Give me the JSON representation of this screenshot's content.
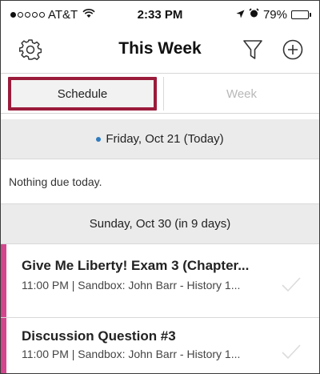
{
  "status_bar": {
    "carrier": "AT&T",
    "time": "2:33 PM",
    "battery": "79%",
    "battery_level": 0.79
  },
  "nav": {
    "title": "This Week",
    "icons": [
      "gear-icon",
      "filter-icon",
      "plus-circle-icon"
    ]
  },
  "segments": {
    "schedule": "Schedule",
    "week": "Week",
    "selected": "schedule"
  },
  "sections": [
    {
      "header": "Friday, Oct 21 (Today)",
      "empty_message": "Nothing due today."
    },
    {
      "header": "Sunday, Oct 30 (in 9 days)",
      "items": [
        {
          "title": "Give Me Liberty! Exam 3 (Chapter...",
          "subtitle": "11:00 PM | Sandbox: John Barr - History 1..."
        },
        {
          "title": "Discussion Question #3",
          "subtitle": "11:00 PM | Sandbox: John Barr - History 1..."
        }
      ]
    }
  ],
  "colors": {
    "selected_border": "#9b1b3b",
    "item_accent": "#d4468e",
    "today_dot": "#2f7bbf",
    "header_bg": "#ebebeb"
  }
}
